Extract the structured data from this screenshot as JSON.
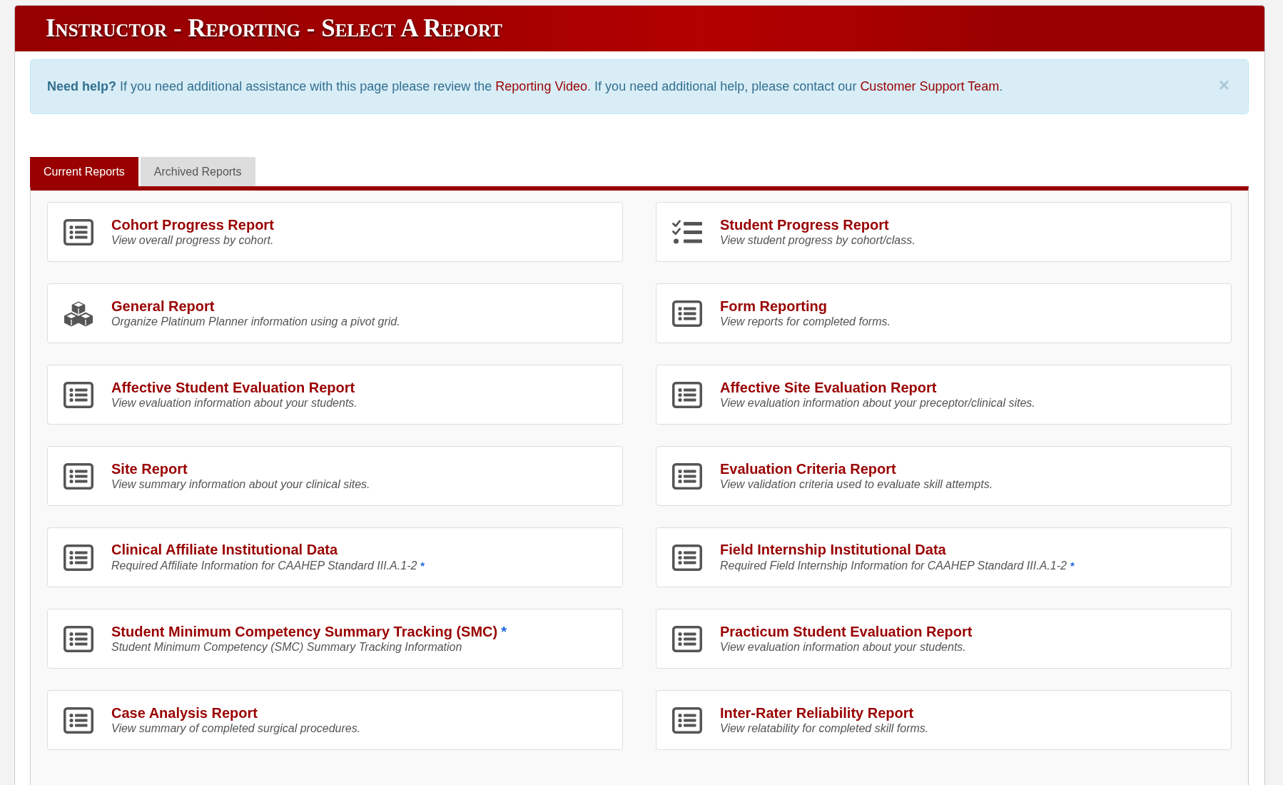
{
  "header": {
    "title": "Instructor - Reporting - Select A Report"
  },
  "alert": {
    "segments": [
      {
        "kind": "bold",
        "text": "Need help?"
      },
      {
        "kind": "text",
        "text": " If you need additional assistance with this page please review the "
      },
      {
        "kind": "link",
        "text": "Reporting Video"
      },
      {
        "kind": "text",
        "text": ". If you need additional help, please contact our "
      },
      {
        "kind": "link",
        "text": "Customer Support Team"
      },
      {
        "kind": "text",
        "text": "."
      }
    ],
    "close": "×"
  },
  "tabs": [
    {
      "label": "Current Reports",
      "selected": true
    },
    {
      "label": "Archived Reports",
      "selected": false
    }
  ],
  "reports": [
    {
      "kind": "list",
      "title": "Cohort Progress Report",
      "description": "View overall progress by cohort."
    },
    {
      "kind": "checklist",
      "title": "Student Progress Report",
      "description": "View student progress by cohort/class."
    },
    {
      "kind": "cubes",
      "title": "General Report",
      "description": "Organize Platinum Planner information using a pivot grid."
    },
    {
      "kind": "list",
      "title": "Form Reporting",
      "description": "View reports for completed forms."
    },
    {
      "kind": "list",
      "title": "Affective Student Evaluation Report",
      "description": "View evaluation information about your students."
    },
    {
      "kind": "list",
      "title": "Affective Site Evaluation Report",
      "description": "View evaluation information about your preceptor/clinical sites."
    },
    {
      "kind": "list",
      "title": "Site Report",
      "description": "View summary information about your clinical sites."
    },
    {
      "kind": "list",
      "title": "Evaluation Criteria Report",
      "description": "View validation criteria used to evaluate skill attempts."
    },
    {
      "kind": "list",
      "title": "Clinical Affiliate Institutional Data",
      "description": "Required Affiliate Information for CAAHEP Standard III.A.1-2",
      "description_note": "*"
    },
    {
      "kind": "list",
      "title": "Field Internship Institutional Data",
      "description": "Required Field Internship Information for CAAHEP Standard III.A.1-2",
      "description_note": "*"
    },
    {
      "kind": "list",
      "title": "Student Minimum Competency Summary Tracking (SMC)",
      "title_note": "*",
      "description": "Student Minimum Competency (SMC) Summary Tracking Information"
    },
    {
      "kind": "list",
      "title": "Practicum Student Evaluation Report",
      "description": "View evaluation information about your students."
    },
    {
      "kind": "list",
      "title": "Case Analysis Report",
      "description": "View summary of completed surgical procedures."
    },
    {
      "kind": "list",
      "title": "Inter-Rater Reliability Report",
      "description": "View relatability for completed skill forms."
    }
  ]
}
